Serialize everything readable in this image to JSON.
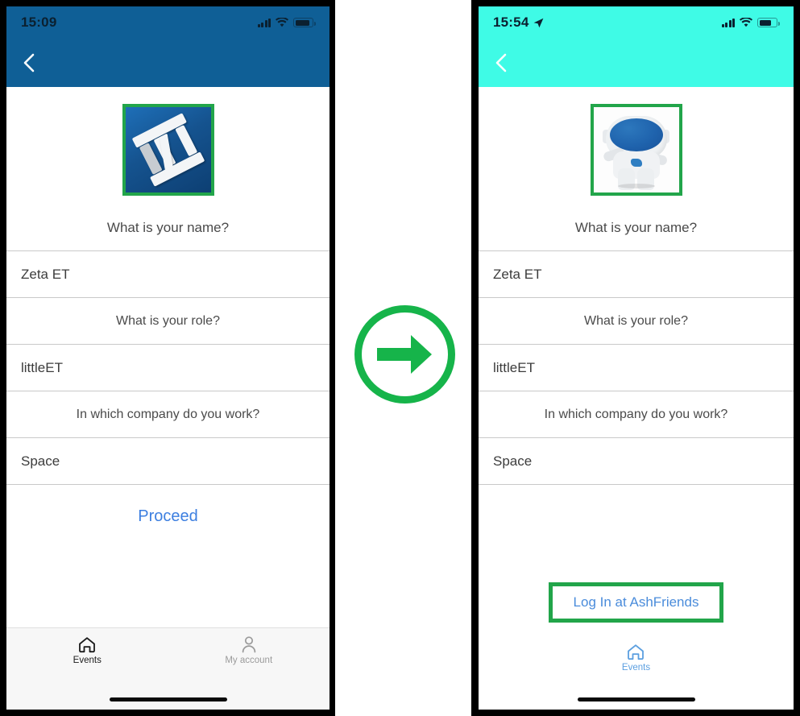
{
  "screens": [
    {
      "id": "before",
      "theme_color": "#0f5f96",
      "status": {
        "time": "15:09",
        "has_location_arrow": false,
        "signal_icon": "signal-bars-icon",
        "wifi_icon": "wifi-icon",
        "battery_icon": "battery-icon"
      },
      "nav": {
        "back_icon": "back-chevron-icon"
      },
      "avatar": {
        "icon": "app-logo-linkedin-icon",
        "highlighted": true
      },
      "prompt_name": "What is your name?",
      "rows": [
        {
          "type": "value",
          "text": "Zeta ET"
        },
        {
          "type": "prompt",
          "text": "What is your role?"
        },
        {
          "type": "value",
          "text": "littleET"
        },
        {
          "type": "prompt",
          "text": "In which company do you work?"
        },
        {
          "type": "value",
          "text": "Space"
        }
      ],
      "action": {
        "label": "Proceed",
        "color": "#3d7fe0",
        "highlighted": false
      },
      "tabs": [
        {
          "label": "Events",
          "icon": "home-icon",
          "state": "active"
        },
        {
          "label": "My account",
          "icon": "person-icon",
          "state": "inactive"
        }
      ]
    },
    {
      "id": "after",
      "theme_color": "#3ffbe6",
      "status": {
        "time": "15:54",
        "has_location_arrow": true,
        "signal_icon": "signal-bars-icon",
        "wifi_icon": "wifi-icon",
        "battery_icon": "battery-icon"
      },
      "nav": {
        "back_icon": "back-chevron-icon"
      },
      "avatar": {
        "icon": "astronaut-mascot-icon",
        "highlighted": true
      },
      "prompt_name": "What is your name?",
      "rows": [
        {
          "type": "value",
          "text": "Zeta ET"
        },
        {
          "type": "prompt",
          "text": "What is your role?"
        },
        {
          "type": "value",
          "text": "littleET"
        },
        {
          "type": "prompt",
          "text": "In which company do you work?"
        },
        {
          "type": "value",
          "text": "Space"
        }
      ],
      "action": {
        "label": "Log In at AshFriends",
        "color": "#4a8cdb",
        "highlighted": true
      },
      "tabs": [
        {
          "label": "Events",
          "icon": "home-icon",
          "state": "blue"
        }
      ]
    }
  ],
  "transition": {
    "icon": "arrow-right-circle-icon",
    "color": "#16b44a"
  },
  "highlight_color": "#22a54a"
}
